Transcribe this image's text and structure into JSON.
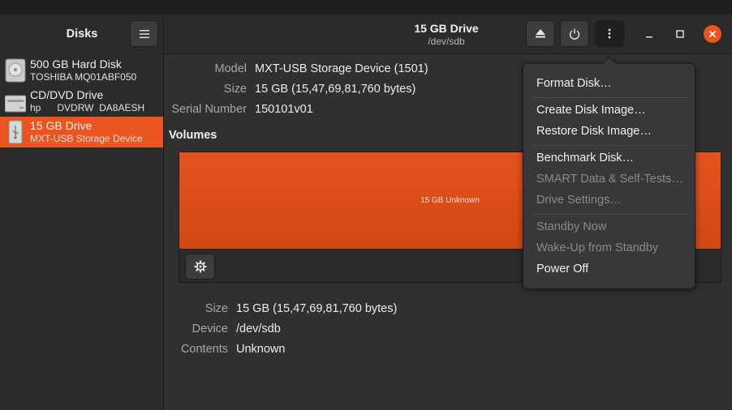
{
  "app": {
    "title": "Disks"
  },
  "header": {
    "drive_title": "15 GB Drive",
    "drive_path": "/dev/sdb"
  },
  "icons": {
    "menu": "hamburger-icon",
    "eject": "eject-icon",
    "power": "power-icon",
    "more": "vertical-dots-icon",
    "minimize": "minimize-icon",
    "maximize": "maximize-icon",
    "close": "close-icon",
    "settings": "gear-icon"
  },
  "colors": {
    "accent": "#e95420",
    "volume": "#dd4c1a",
    "background": "#303030"
  },
  "sidebar": {
    "items": [
      {
        "name": "500 GB Hard Disk",
        "sub": "TOSHIBA MQ01ABF050",
        "icon": "hard-disk-icon",
        "selected": false
      },
      {
        "name": "CD/DVD Drive",
        "sub": "hp      DVDRW  DA8AESH",
        "icon": "optical-drive-icon",
        "selected": false
      },
      {
        "name": "15 GB Drive",
        "sub": "MXT-USB Storage Device",
        "icon": "usb-drive-icon",
        "selected": true
      }
    ]
  },
  "drive": {
    "model_label": "Model",
    "model": "MXT-USB Storage Device (1501)",
    "size_label": "Size",
    "size": "15 GB (15,47,69,81,760 bytes)",
    "serial_label": "Serial Number",
    "serial": "150101v01"
  },
  "volumes": {
    "title": "Volumes",
    "bar_label": "15 GB Unknown",
    "size_label": "Size",
    "size": "15 GB (15,47,69,81,760 bytes)",
    "device_label": "Device",
    "device": "/dev/sdb",
    "contents_label": "Contents",
    "contents": "Unknown"
  },
  "menu": {
    "items": [
      {
        "label": "Format Disk…",
        "enabled": true
      },
      {
        "label": "Create Disk Image…",
        "enabled": true
      },
      {
        "label": "Restore Disk Image…",
        "enabled": true
      },
      {
        "label": "Benchmark Disk…",
        "enabled": true
      },
      {
        "label": "SMART Data & Self-Tests…",
        "enabled": false
      },
      {
        "label": "Drive Settings…",
        "enabled": false
      },
      {
        "label": "Standby Now",
        "enabled": false
      },
      {
        "label": "Wake-Up from Standby",
        "enabled": false
      },
      {
        "label": "Power Off",
        "enabled": true
      }
    ]
  }
}
